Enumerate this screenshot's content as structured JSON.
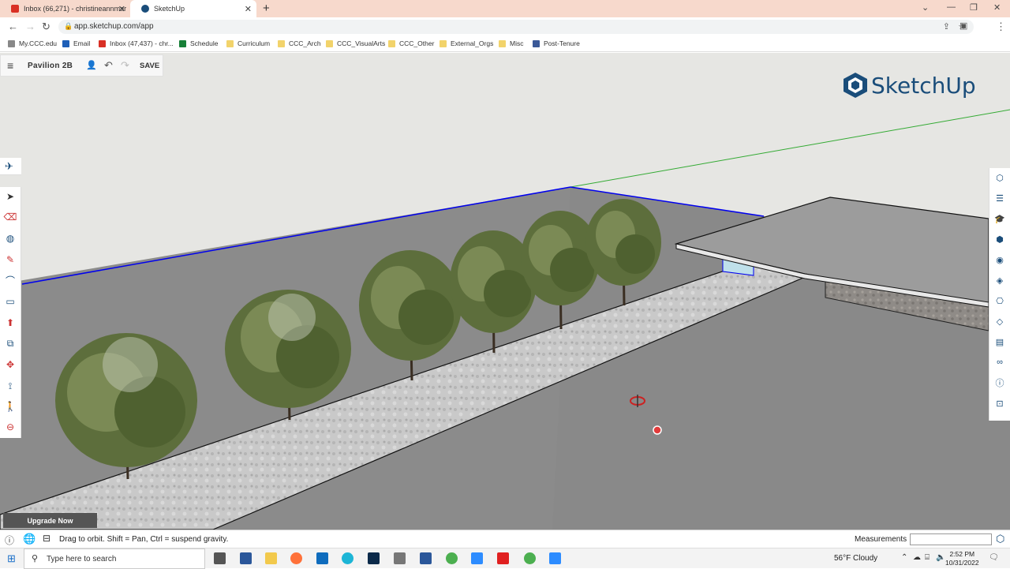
{
  "browser": {
    "tabs": [
      {
        "title": "Inbox (66,271) - christineannmar",
        "active": false
      },
      {
        "title": "SketchUp",
        "active": true
      }
    ],
    "url": "app.sketchup.com/app",
    "bookmarks": [
      "My.CCC.edu",
      "Email",
      "Inbox (47,437) - chr...",
      "Schedule",
      "Curriculum",
      "CCC_Arch",
      "CCC_VisualArts",
      "CCC_Other",
      "External_Orgs",
      "Misc",
      "Post-Tenure"
    ]
  },
  "app": {
    "project_name": "Pavilion 2B",
    "save_label": "SAVE",
    "logo": "SketchUp",
    "upgrade_label": "Upgrade Now",
    "status_text": "Drag to orbit. Shift = Pan, Ctrl = suspend gravity.",
    "measurements_label": "Measurements",
    "measurements_value": ""
  },
  "taskbar": {
    "search_placeholder": "Type here to search",
    "weather": "56°F  Cloudy",
    "time": "2:52 PM",
    "date": "10/31/2022"
  },
  "colors": {
    "tab_bar": "#f7d9cc",
    "logo_blue": "#1a4d7a",
    "ground": "#8a8a8a",
    "sky": "#e6e6e3",
    "edge_blue": "#0000ee",
    "axis_green": "#33aa33"
  }
}
